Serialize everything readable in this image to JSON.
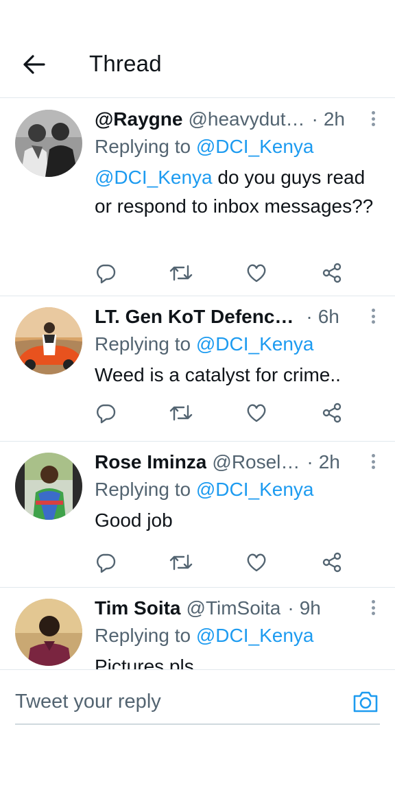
{
  "header": {
    "title": "Thread",
    "back_icon": "arrow-left-icon"
  },
  "tweets": [
    {
      "display_name": "@Raygne",
      "handle": "@heavydut…",
      "separator": "·",
      "time": "2h",
      "replying_prefix": "Replying to",
      "replying_to": "@DCI_Kenya",
      "text_mention": "@DCI_Kenya",
      "text": " do you guys read or respond to inbox messages??"
    },
    {
      "display_name": "LT. Gen KoT Defenc…",
      "handle": "",
      "separator": "·",
      "time": "6h",
      "replying_prefix": "Replying to",
      "replying_to": "@DCI_Kenya",
      "text_mention": "",
      "text": "Weed is a catalyst for crime.."
    },
    {
      "display_name": "Rose Iminza",
      "handle": "@Rosel…",
      "separator": "·",
      "time": "2h",
      "replying_prefix": "Replying to",
      "replying_to": "@DCI_Kenya",
      "text_mention": "",
      "text": "Good job"
    },
    {
      "display_name": "Tim Soita",
      "handle": "@TimSoita",
      "separator": "·",
      "time": "9h",
      "replying_prefix": "Replying to",
      "replying_to": "@DCI_Kenya",
      "text_mention": "",
      "text": "Pictures pls"
    }
  ],
  "action_icons": [
    "reply-icon",
    "retweet-icon",
    "like-icon",
    "share-icon"
  ],
  "composer": {
    "placeholder": "Tweet your reply",
    "camera_icon": "camera-icon"
  },
  "colors": {
    "accent": "#1d9bf0",
    "text": "#0f1419",
    "secondary": "#536471",
    "divider": "#e1e8ed"
  }
}
